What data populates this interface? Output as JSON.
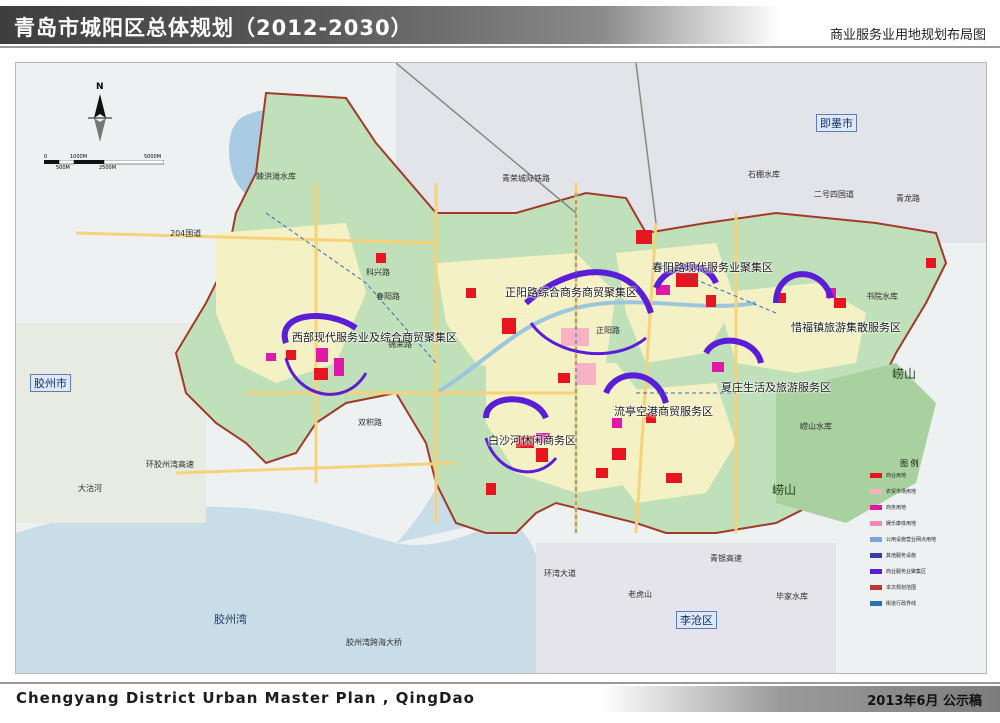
{
  "header": {
    "title": "青岛市城阳区总体规划（2012-2030）",
    "subtitle": "商业服务业用地规划布局图"
  },
  "footer": {
    "english_title": "Chengyang District Urban Master Plan , QingDao",
    "date": "2013年6月  公示稿"
  },
  "north_label": "N",
  "scale": {
    "top_labels": [
      "0",
      "1000M",
      "5000M"
    ],
    "bottom_labels": [
      "500M",
      "2500M"
    ]
  },
  "clusters": [
    "正阳路综合商务商贸聚集区",
    "春阳路现代服务业聚集区",
    "惜福镇旅游集散服务区",
    "西部现代服务业及综合商贸聚集区",
    "夏庄生活及旅游服务区",
    "流亭空港商贸服务区",
    "白沙河休闲商务区"
  ],
  "cities": [
    "即墨市",
    "胶州市",
    "李沧区"
  ],
  "water": [
    "胶州湾",
    "棘洪滩水库",
    "书院水库",
    "崂山水库",
    "石棚水库",
    "毕家水库",
    "老虎山"
  ],
  "roads": [
    "204国道",
    "青荣城际铁路",
    "环湾大道",
    "环胶州湾高速",
    "胶州湾跨海大桥",
    "春阳路",
    "正阳路",
    "科兴路",
    "锦荣路",
    "双积路",
    "二号四国道",
    "青龙路",
    "大沽河",
    "青银高速"
  ],
  "mountains": [
    "崂山",
    "崂山"
  ],
  "legend": {
    "title": "图  例",
    "items": [
      {
        "label": "商业用地",
        "color": "#e8141f"
      },
      {
        "label": "农贸市场用地",
        "color": "#f7b2c4"
      },
      {
        "label": "商务用地",
        "color": "#e01aa6"
      },
      {
        "label": "娱乐康体用地",
        "color": "#f08ab8"
      },
      {
        "label": "公用设施营业网点用地",
        "color": "#7aa6dc"
      },
      {
        "label": "其他服务设施",
        "color": "#3a3aa8"
      },
      {
        "label": "商业服务业聚集区",
        "color": "#5a1ed8"
      },
      {
        "label": "本次规划范围",
        "color": "#c0392b"
      },
      {
        "label": "街道行政界线",
        "color": "#2e6db8"
      }
    ]
  }
}
